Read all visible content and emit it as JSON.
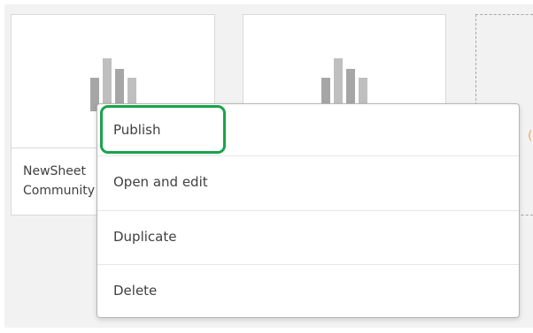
{
  "colors": {
    "bar_dark": "#a6a6a6",
    "bar_light": "#bfbfbf",
    "highlight": "#1aa34a",
    "accent": "#f0a85a"
  },
  "cards": [
    {
      "title_line1": "NewSheet",
      "title_line2": "Community"
    },
    {
      "title_line1": "",
      "title_line2": ""
    }
  ],
  "context_menu": {
    "items": [
      {
        "label": "Publish"
      },
      {
        "label": "Open and edit"
      },
      {
        "label": "Duplicate"
      },
      {
        "label": "Delete"
      }
    ]
  }
}
